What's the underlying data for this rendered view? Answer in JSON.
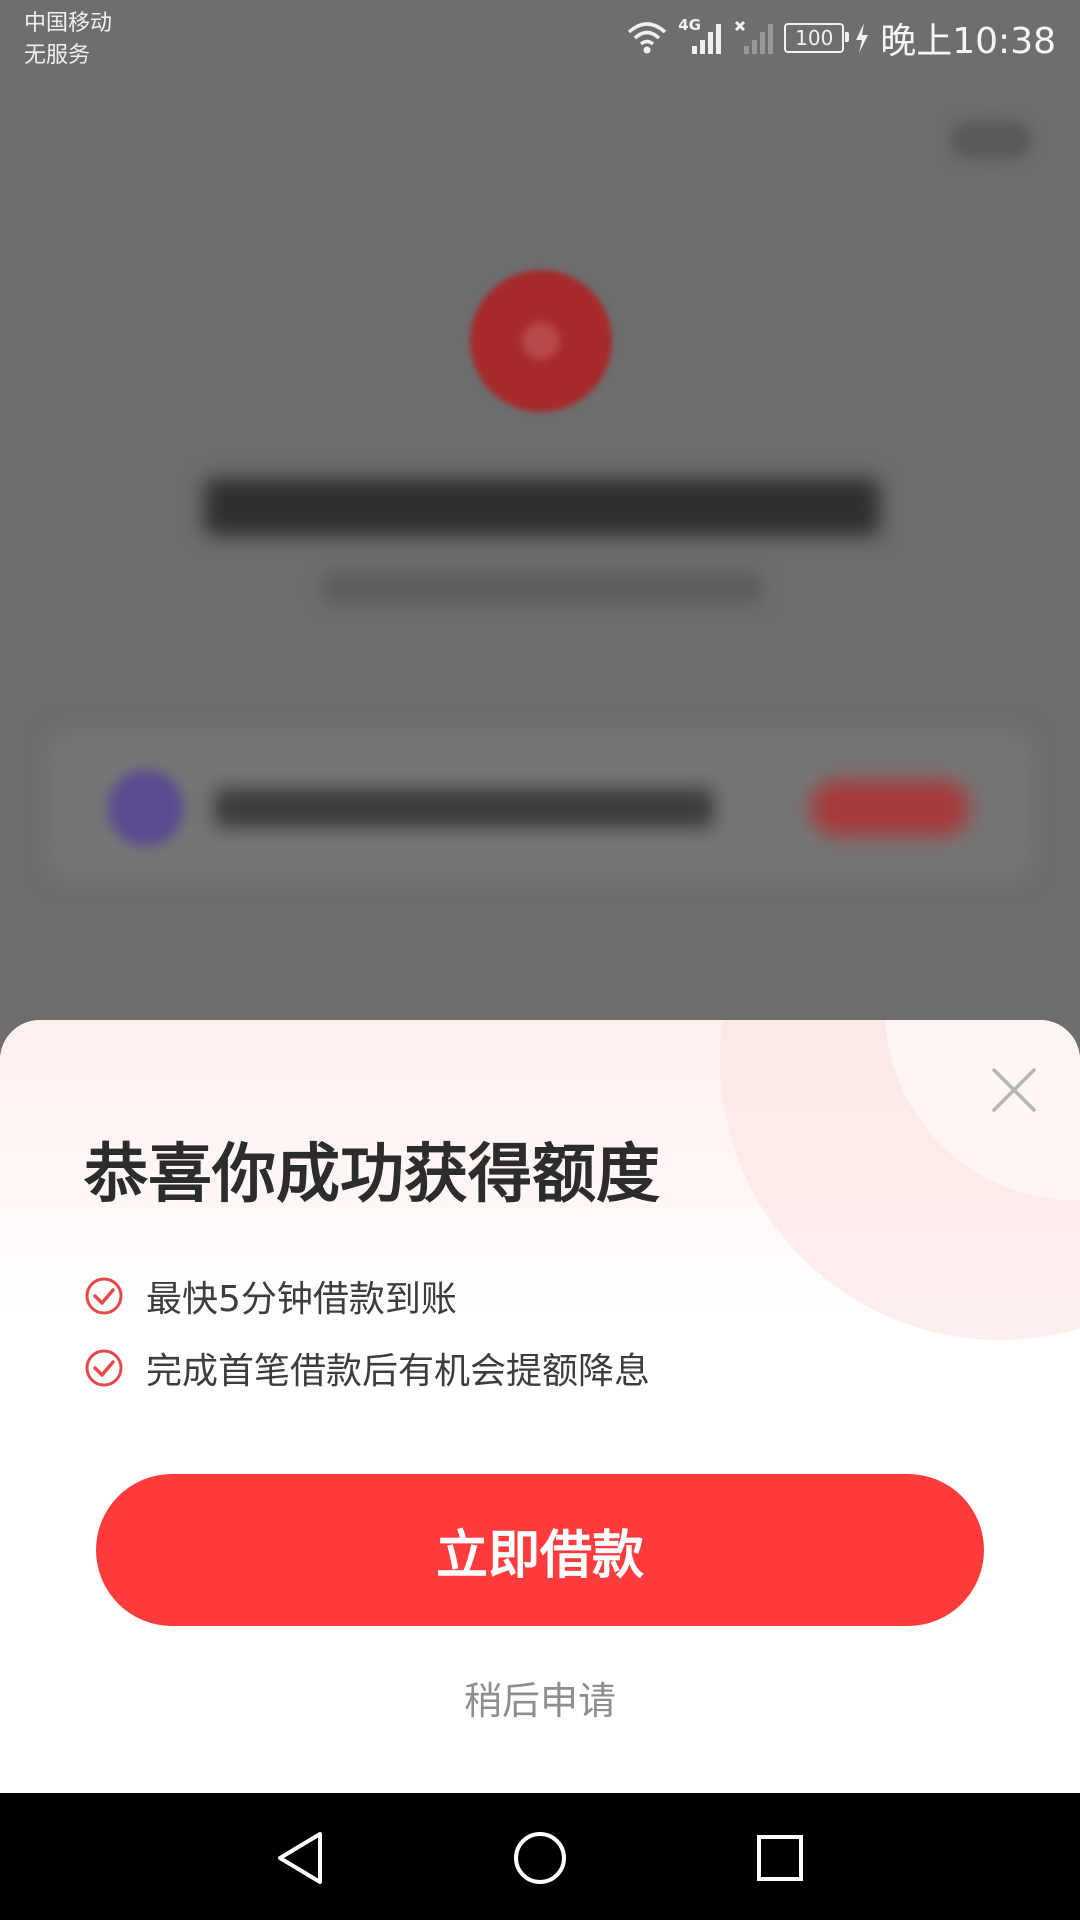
{
  "status_bar": {
    "carrier_line1": "中国移动",
    "carrier_line2": "无服务",
    "network_type": "4G",
    "battery_level": "100",
    "time": "晚上10:38",
    "icons": [
      "wifi-icon",
      "signal-icon",
      "no-signal-icon",
      "battery-icon",
      "charging-icon"
    ]
  },
  "sheet": {
    "title": "恭喜你成功获得额度",
    "benefits": [
      {
        "text": "最快5分钟借款到账",
        "icon": "check-circle-icon"
      },
      {
        "text": "完成首笔借款后有机会提额降息",
        "icon": "check-circle-icon"
      }
    ],
    "primary_button": "立即借款",
    "secondary_link": "稍后申请",
    "close_icon": "close-icon"
  },
  "nav_bar": {
    "icons": [
      "back-icon",
      "home-icon",
      "recents-icon"
    ]
  },
  "colors": {
    "accent": "#ff3b3b",
    "check": "#e94848",
    "overlay": "#6e6e6e"
  }
}
